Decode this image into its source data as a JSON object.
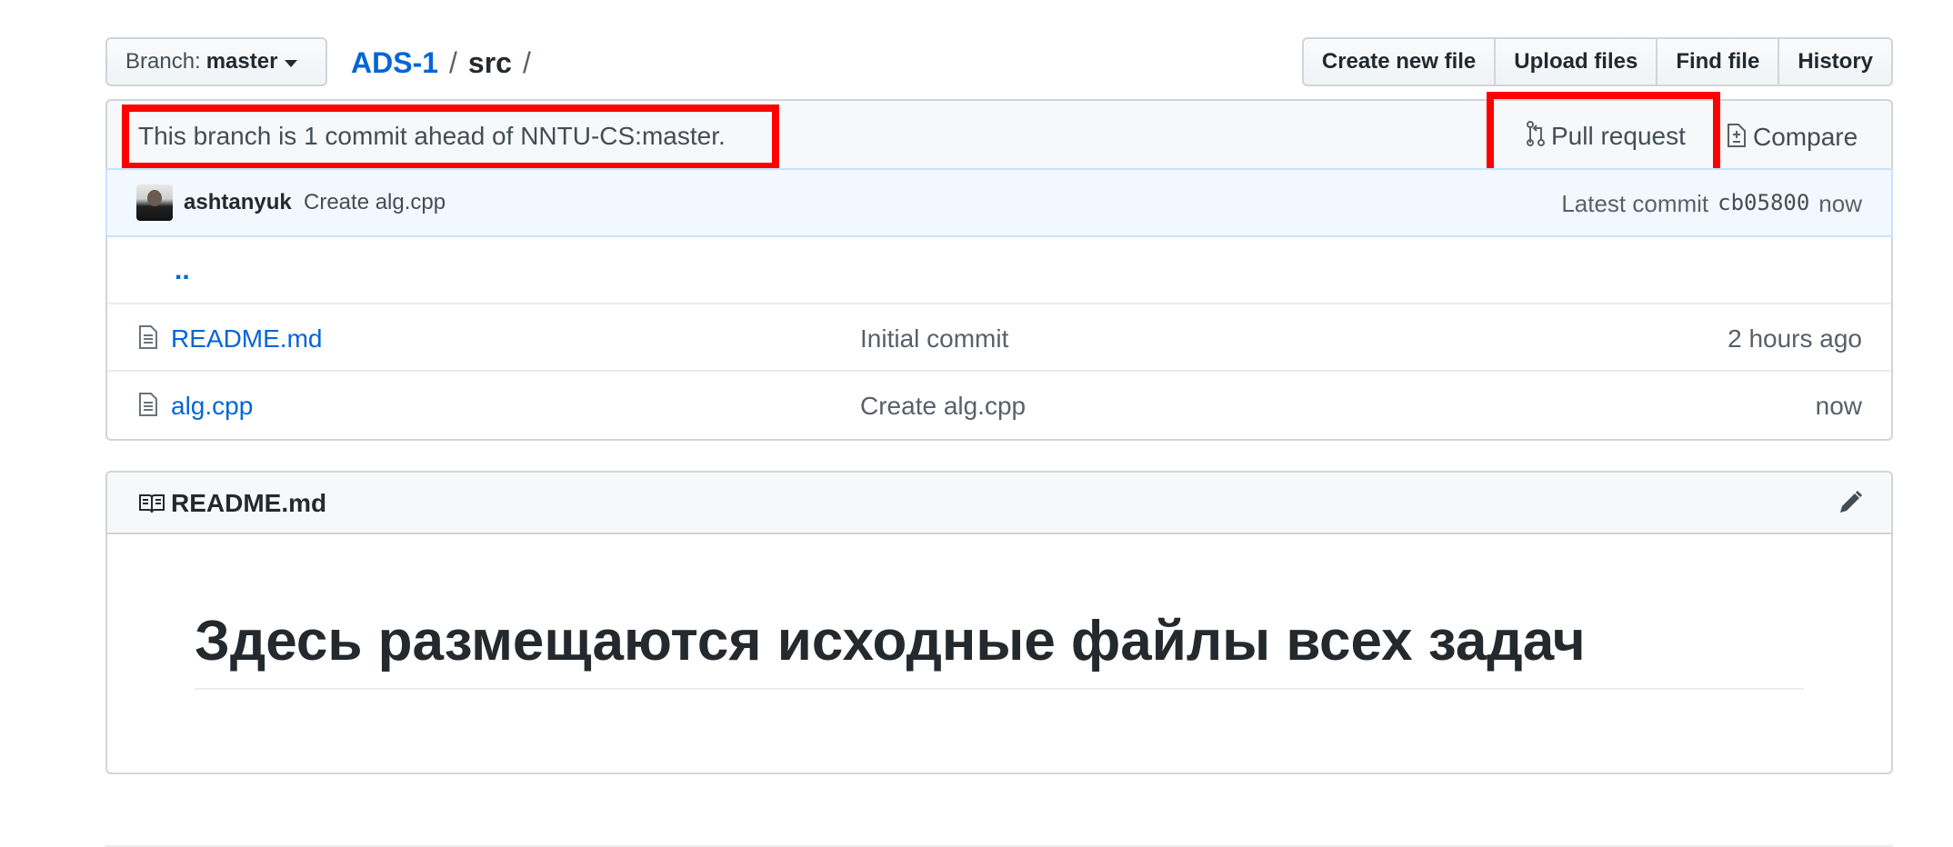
{
  "branch": {
    "label": "Branch:",
    "value": "master"
  },
  "breadcrumb": {
    "repo": "ADS-1",
    "sep1": "/",
    "folder": "src",
    "sep2": "/"
  },
  "actions": {
    "create": "Create new file",
    "upload": "Upload files",
    "find": "Find file",
    "history": "History"
  },
  "branch_info": {
    "text": "This branch is 1 commit ahead of NNTU-CS:master.",
    "pull_request": "Pull request",
    "compare": "Compare"
  },
  "commit": {
    "author": "ashtanyuk",
    "message": "Create alg.cpp",
    "latest_label": "Latest commit",
    "sha": "cb05800",
    "time": "now"
  },
  "files": {
    "parent": "..",
    "rows": [
      {
        "name": "README.md",
        "message": "Initial commit",
        "age": "2 hours ago"
      },
      {
        "name": "alg.cpp",
        "message": "Create alg.cpp",
        "age": "now"
      }
    ]
  },
  "readme": {
    "title": "README.md",
    "heading": "Здесь размещаются исходные файлы всех задач"
  },
  "colors": {
    "highlight": "#ff0000",
    "link": "#0366d6"
  },
  "icons": [
    "caret-down-icon",
    "pull-request-icon",
    "compare-icon",
    "file-icon",
    "book-icon",
    "pencil-icon"
  ]
}
